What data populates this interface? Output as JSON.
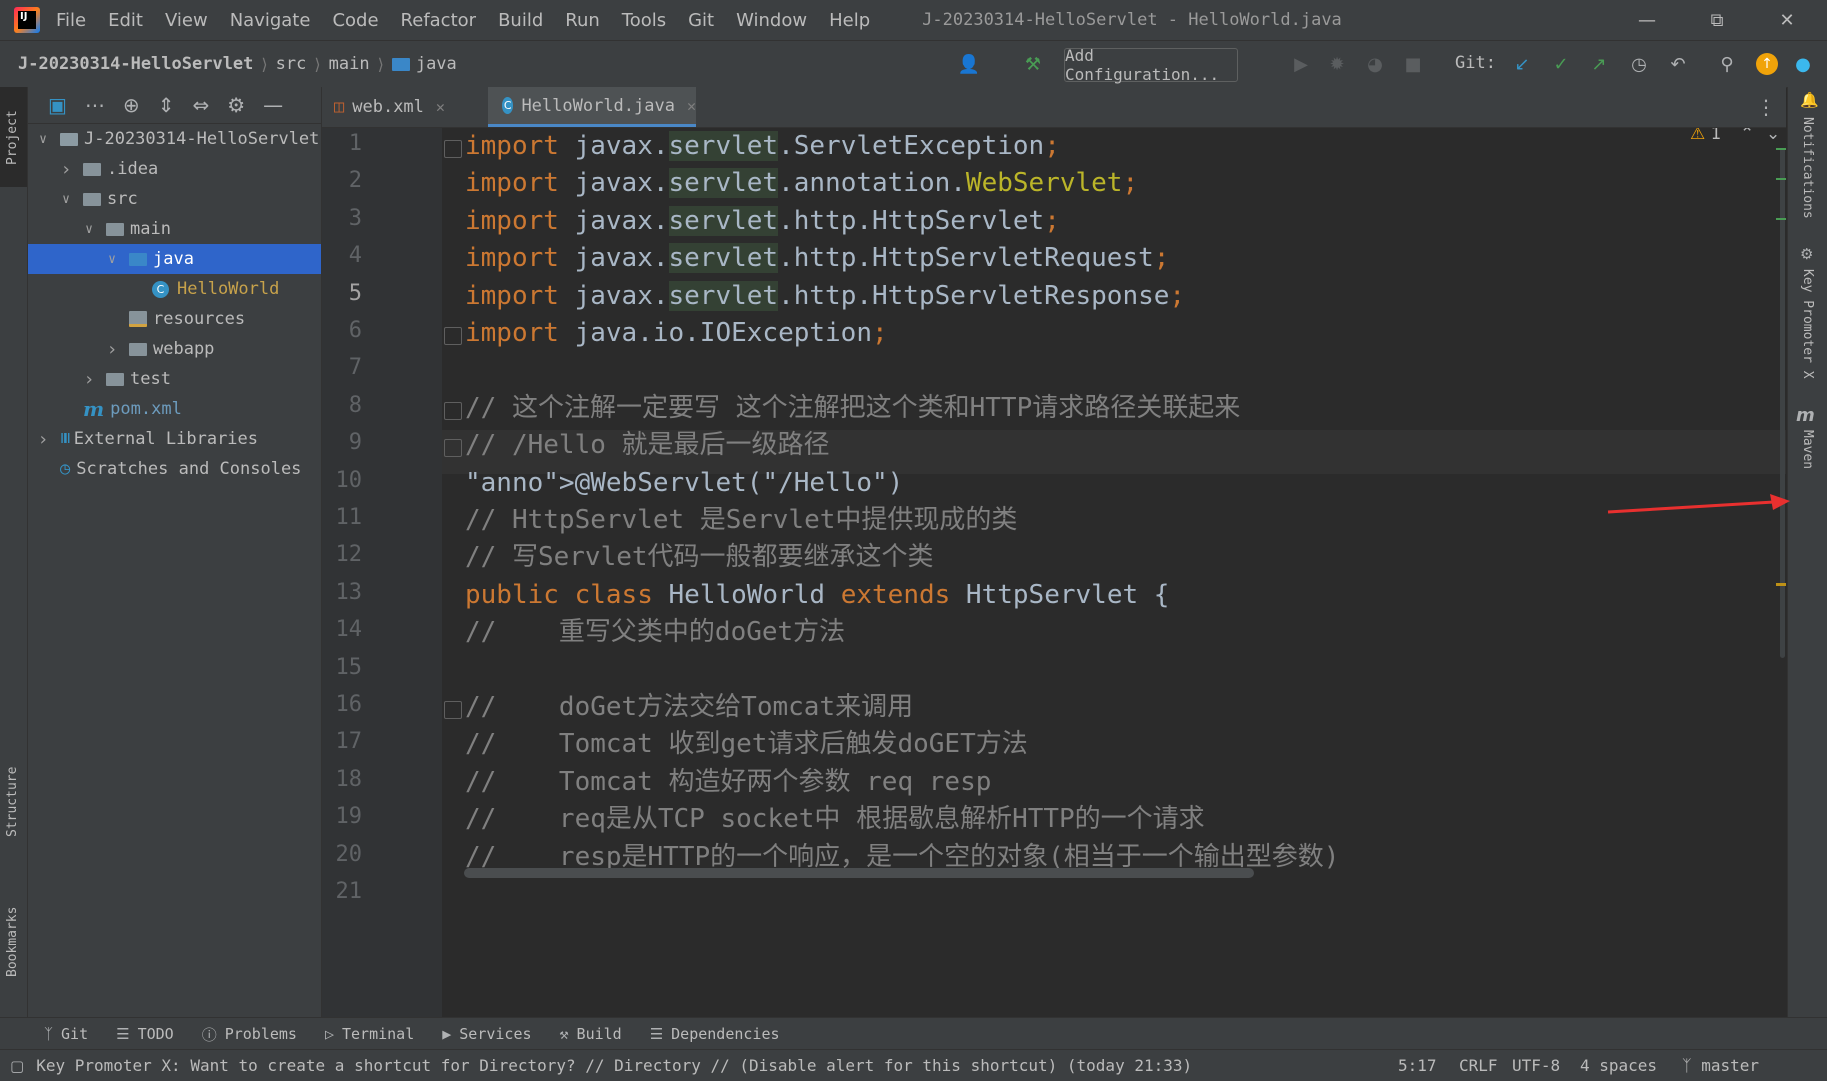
{
  "menubar": {
    "items": [
      "File",
      "Edit",
      "View",
      "Navigate",
      "Code",
      "Refactor",
      "Build",
      "Run",
      "Tools",
      "Git",
      "Window",
      "Help"
    ],
    "title": "J-20230314-HelloServlet - HelloWorld.java"
  },
  "navbar": {
    "crumbs": [
      "J-20230314-HelloServlet",
      "src",
      "main",
      "java"
    ],
    "add_config": "Add Configuration...",
    "git_label": "Git:"
  },
  "left_strip": {
    "project": "Project",
    "structure": "Structure",
    "bookmarks": "Bookmarks"
  },
  "right_strip": {
    "notifications": "Notifications",
    "key_promoter": "Key Promoter X",
    "maven": "Maven"
  },
  "tree": [
    {
      "label": "J-20230314-HelloServlet",
      "icon": "module-folder-icon",
      "expanded": true,
      "level": 0
    },
    {
      "label": ".idea",
      "icon": "folder-icon",
      "expanded": false,
      "level": 1
    },
    {
      "label": "src",
      "icon": "folder-icon",
      "expanded": true,
      "level": 1
    },
    {
      "label": "main",
      "icon": "folder-icon",
      "expanded": true,
      "level": 2
    },
    {
      "label": "java",
      "icon": "source-folder-icon",
      "expanded": true,
      "level": 3,
      "selected": true
    },
    {
      "label": "HelloWorld",
      "icon": "java-class-icon",
      "level": 4
    },
    {
      "label": "resources",
      "icon": "resources-folder-icon",
      "level": 3
    },
    {
      "label": "webapp",
      "icon": "folder-icon",
      "expanded": false,
      "level": 3
    },
    {
      "label": "test",
      "icon": "folder-icon",
      "expanded": false,
      "level": 2
    },
    {
      "label": "pom.xml",
      "icon": "maven-icon",
      "level": 1
    },
    {
      "label": "External Libraries",
      "icon": "libraries-icon",
      "expanded": false,
      "level": 0
    },
    {
      "label": "Scratches and Consoles",
      "icon": "scratches-icon",
      "level": 0
    }
  ],
  "tabs": [
    {
      "label": "web.xml",
      "icon": "xml-file-icon",
      "active": false
    },
    {
      "label": "HelloWorld.java",
      "icon": "java-class-icon",
      "active": true
    }
  ],
  "editor": {
    "warnings": "1",
    "current_line": 5,
    "lines": [
      "import javax.servlet.ServletException;",
      "import javax.servlet.annotation.WebServlet;",
      "import javax.servlet.http.HttpServlet;",
      "import javax.servlet.http.HttpServletRequest;",
      "import javax.servlet.http.HttpServletResponse;",
      "import java.io.IOException;",
      "",
      "// 这个注解一定要写 这个注解把这个类和HTTP请求路径关联起来",
      "// /Hello 就是最后一级路径",
      "@WebServlet(\"/Hello\")",
      "// HttpServlet 是Servlet中提供现成的类",
      "// 写Servlet代码一般都要继承这个类",
      "public class HelloWorld extends HttpServlet {",
      "//    重写父类中的doGet方法",
      "",
      "//    doGet方法交给Tomcat来调用",
      "//    Tomcat 收到get请求后触发doGET方法",
      "//    Tomcat 构造好两个参数 req resp",
      "//    req是从TCP socket中 根据歇息解析HTTP的一个请求",
      "//    resp是HTTP的一个响应，是一个空的对象(相当于一个输出型参数)"
    ]
  },
  "bottom_tools": [
    "Git",
    "TODO",
    "Problems",
    "Terminal",
    "Services",
    "Build",
    "Dependencies"
  ],
  "status": {
    "message": "Key Promoter X: Want to create a shortcut for Directory? // Directory // (Disable alert for this shortcut) (today 21:33)",
    "position": "5:17",
    "line_sep": "CRLF",
    "encoding": "UTF-8",
    "indent": "4 spaces",
    "branch": "master"
  },
  "colors": {
    "accent": "#2f65ca",
    "keyword": "#cc7832",
    "annotation": "#bbb529",
    "string": "#6a8759",
    "comment": "#808080"
  }
}
